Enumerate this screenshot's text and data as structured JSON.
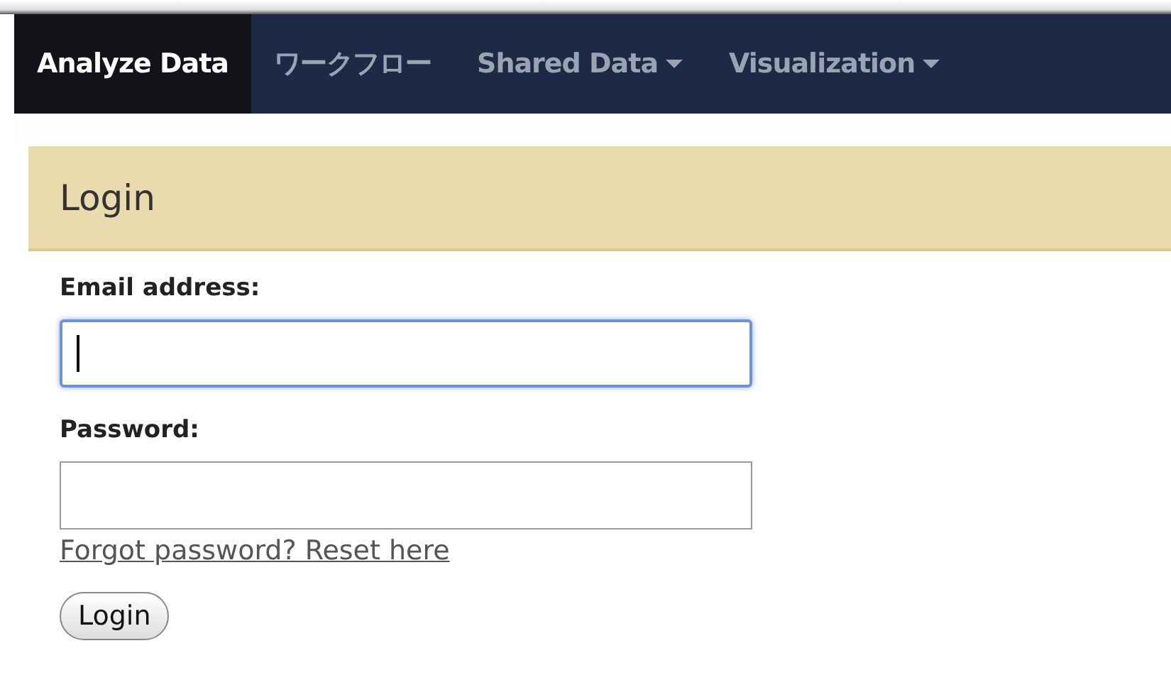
{
  "nav": [
    {
      "label": "Analyze Data",
      "selected": true,
      "dropdown": false
    },
    {
      "label": "ワークフロー",
      "selected": false,
      "dropdown": false
    },
    {
      "label": "Shared Data",
      "selected": false,
      "dropdown": true
    },
    {
      "label": "Visualization",
      "selected": false,
      "dropdown": true
    }
  ],
  "panel": {
    "title": "Login"
  },
  "fields": [
    {
      "label": "Email address:",
      "focused": true
    },
    {
      "label": "Password:",
      "focused": false
    }
  ],
  "link": "Forgot password? Reset here",
  "button": "Login"
}
